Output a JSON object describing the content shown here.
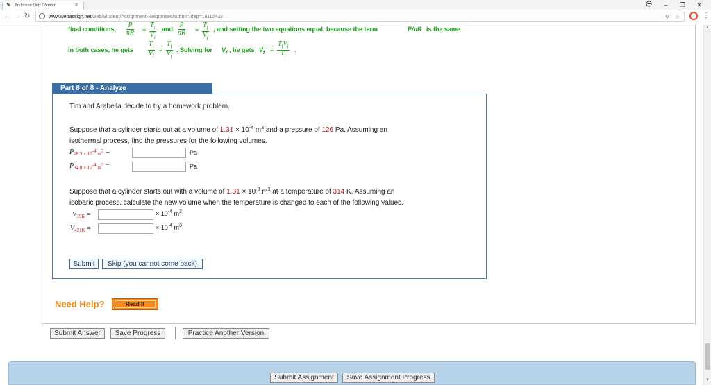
{
  "browser": {
    "tab_title": "Prelecture Quiz Chapter",
    "tab_close": "×",
    "url_host": "www.webassign.net",
    "url_path": "/web/Student/Assignment-Responses/submit?dep=18112432",
    "win_min": "–",
    "win_max": "❐",
    "win_close": "✕",
    "account_icon": "account-icon"
  },
  "solution": {
    "line1_a": "final conditions,",
    "line1_frac1_num": "P",
    "line1_frac1_den": "nR",
    "line1_eq1": "=",
    "line1_frac2_num": "T",
    "line1_frac2_num_sub": "i",
    "line1_frac2_den": "V",
    "line1_frac2_den_sub": "i",
    "line1_and": "and",
    "line1_frac3_num": "P",
    "line1_frac3_den": "nR",
    "line1_eq2": "=",
    "line1_frac4_num": "T",
    "line1_frac4_num_sub": "f",
    "line1_frac4_den": "V",
    "line1_frac4_den_sub": "f",
    "line1_b": ", and setting the two equations equal, because the term",
    "line1_term": "P/nR",
    "line1_c": "is the same",
    "line2_a": "in both cases, he gets",
    "line2_frac1_num": "T",
    "line2_frac1_num_sub": "i",
    "line2_frac1_den": "V",
    "line2_frac1_den_sub": "i",
    "line2_eq": "=",
    "line2_frac2_num": "T",
    "line2_frac2_num_sub": "f",
    "line2_frac2_den": "V",
    "line2_frac2_den_sub": "f",
    "line2_b": ". Solving for",
    "line2_vf": "V",
    "line2_vf_sub": "f",
    "line2_c": ", he gets",
    "line2_vf2": "V",
    "line2_vf2_sub": "f",
    "line2_eq2": "=",
    "line2_frac3_num": "T",
    "line2_frac3_num_sub": "f",
    "line2_frac3_num2": "V",
    "line2_frac3_num2_sub": "i",
    "line2_frac3_den": "T",
    "line2_frac3_den_sub": "i",
    "line2_end": "."
  },
  "part": {
    "header": "Part 8 of 8 - Analyze",
    "intro": "Tim and Arabella decide to try a homework problem.",
    "iso_line1_a": "Suppose that a cylinder starts out at a volume of ",
    "iso_vol": "1.31",
    "iso_times": " × 10",
    "iso_exp": "-4",
    "iso_m": " m",
    "iso_m_exp": "3",
    "iso_line1_b": " and a pressure of ",
    "iso_pressure": "126",
    "iso_line1_c": " Pa. Assuming an",
    "iso_line2": "isothermal process, find the pressures for the following volumes.",
    "p1_sym": "P",
    "p1_sub": "18.3 × 10",
    "p1_sub_exp": "-4",
    "p1_sub_m": " m",
    "p1_sub_m_exp": "3",
    "p1_eq": " =",
    "p1_unit": "Pa",
    "p1_value": "",
    "p2_sym": "P",
    "p2_sub": "34.8 × 10",
    "p2_sub_exp": "-4",
    "p2_sub_m": " m",
    "p2_sub_m_exp": "3",
    "p2_eq": " =",
    "p2_unit": "Pa",
    "p2_value": "",
    "iba_line1_a": "Suppose that a cylinder starts out with a volume of ",
    "iba_vol": "1.31",
    "iba_times": " × 10",
    "iba_exp": "-3",
    "iba_m": " m",
    "iba_m_exp": "3",
    "iba_line1_b": " at a temperature of ",
    "iba_temp": "314",
    "iba_line1_c": " K. Assuming an",
    "iba_line2": "isobaric process, calculate the new volume when the temperature is changed to each of the following values.",
    "v1_sym": "V",
    "v1_sub": "39K",
    "v1_eq": " =",
    "v1_unit_a": "× 10",
    "v1_unit_exp": "-4",
    "v1_unit_m": " m",
    "v1_unit_m_exp": "3",
    "v1_value": "",
    "v2_sym": "V",
    "v2_sub": "421K",
    "v2_eq": " =",
    "v2_unit_a": "× 10",
    "v2_unit_exp": "-4",
    "v2_unit_m": " m",
    "v2_unit_m_exp": "3",
    "v2_value": "",
    "submit": "Submit",
    "skip": "Skip (you cannot come back)"
  },
  "help": {
    "need_help": "Need Help?",
    "read_it": "Read It"
  },
  "actions": {
    "submit_answer": "Submit Answer",
    "save_progress": "Save Progress",
    "practice_another": "Practice Another Version"
  },
  "footer": {
    "submit_assignment": "Submit Assignment",
    "save_assignment_progress": "Save Assignment Progress"
  }
}
